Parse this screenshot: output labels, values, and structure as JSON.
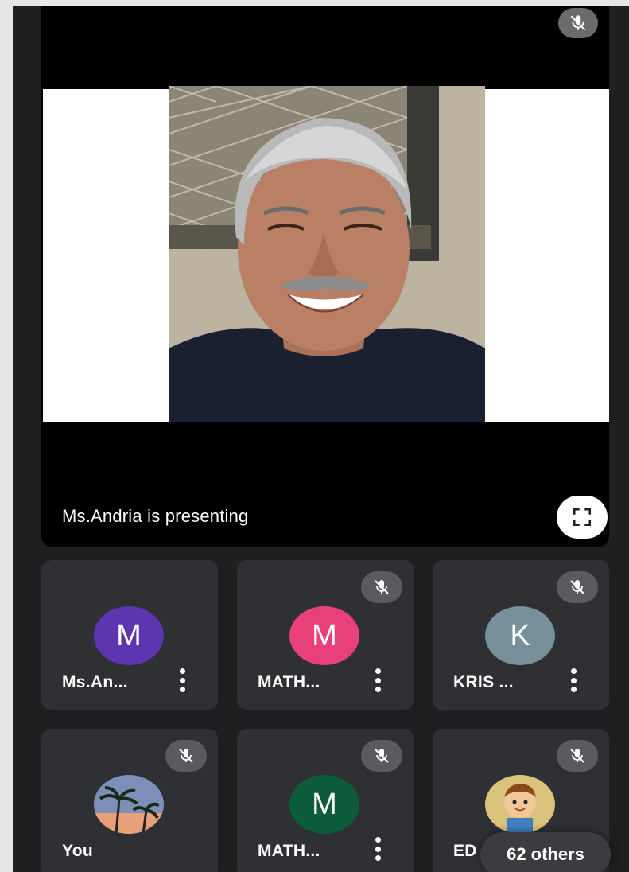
{
  "stage": {
    "presenting_text": "Ms.Andria is presenting",
    "fullscreen_icon": "fullscreen-icon",
    "mic_icon": "mic-off-icon"
  },
  "tiles": [
    {
      "name": "Ms.An...",
      "avatar_letter": "M",
      "avatar_color": "#5e35b1",
      "muted": false,
      "has_more": true
    },
    {
      "name": "MATH...",
      "avatar_letter": "M",
      "avatar_color": "#e8407a",
      "muted": true,
      "has_more": true
    },
    {
      "name": "KRIS ...",
      "avatar_letter": "K",
      "avatar_color": "#78909c",
      "muted": true,
      "has_more": true
    },
    {
      "name": "You",
      "avatar_letter": "",
      "avatar_color": "",
      "muted": true,
      "has_more": false
    },
    {
      "name": "MATH...",
      "avatar_letter": "M",
      "avatar_color": "#0d5c3b",
      "muted": true,
      "has_more": true
    },
    {
      "name": "ED",
      "avatar_letter": "",
      "avatar_color": "",
      "muted": true,
      "has_more": false
    }
  ],
  "others_chip": {
    "label": "62 others"
  }
}
